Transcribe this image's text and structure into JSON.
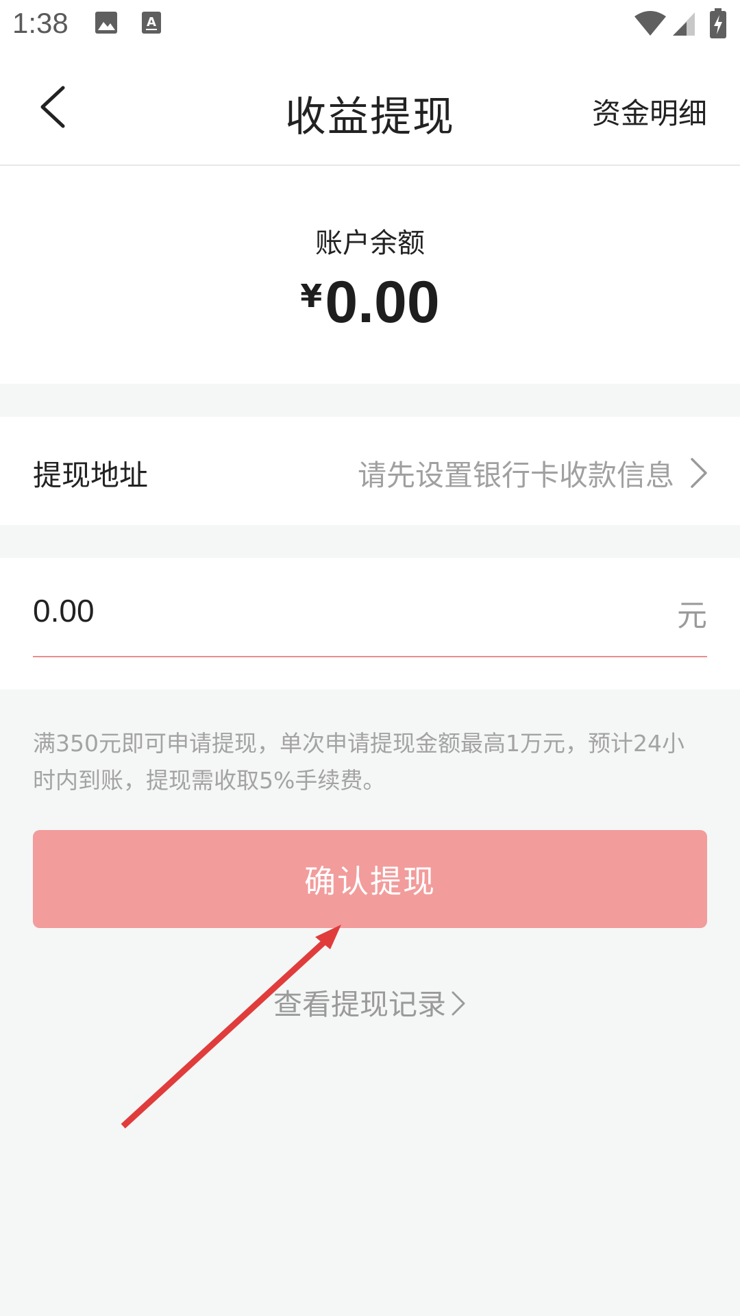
{
  "status_bar": {
    "time": "1:38",
    "icons": [
      "image-icon",
      "text-icon",
      "wifi-icon",
      "signal-icon",
      "battery-charging-icon"
    ]
  },
  "nav": {
    "back_icon": "chevron-left-icon",
    "title": "收益提现",
    "right_link": "资金明细"
  },
  "balance": {
    "label": "账户余额",
    "currency": "¥",
    "amount": "0.00"
  },
  "address": {
    "label": "提现地址",
    "value": "请先设置银行卡收款信息",
    "chevron_icon": "chevron-right-icon"
  },
  "amount_input": {
    "value": "0.00",
    "unit": "元"
  },
  "info_text": "满350元即可申请提现，单次申请提现金额最高1万元，预计24小时内到账，提现需收取5%手续费。",
  "confirm_button": {
    "label": "确认提现"
  },
  "record_link": {
    "label": "查看提现记录",
    "chevron_icon": "chevron-right-icon"
  },
  "colors": {
    "primary_button": "#f29c9c",
    "input_underline": "#e98c8c",
    "annotation_arrow": "#e03c3c",
    "page_background": "#f5f6f6"
  },
  "annotation": {
    "type": "arrow",
    "icon": "red-arrow-icon",
    "points_to": "confirm-button"
  }
}
